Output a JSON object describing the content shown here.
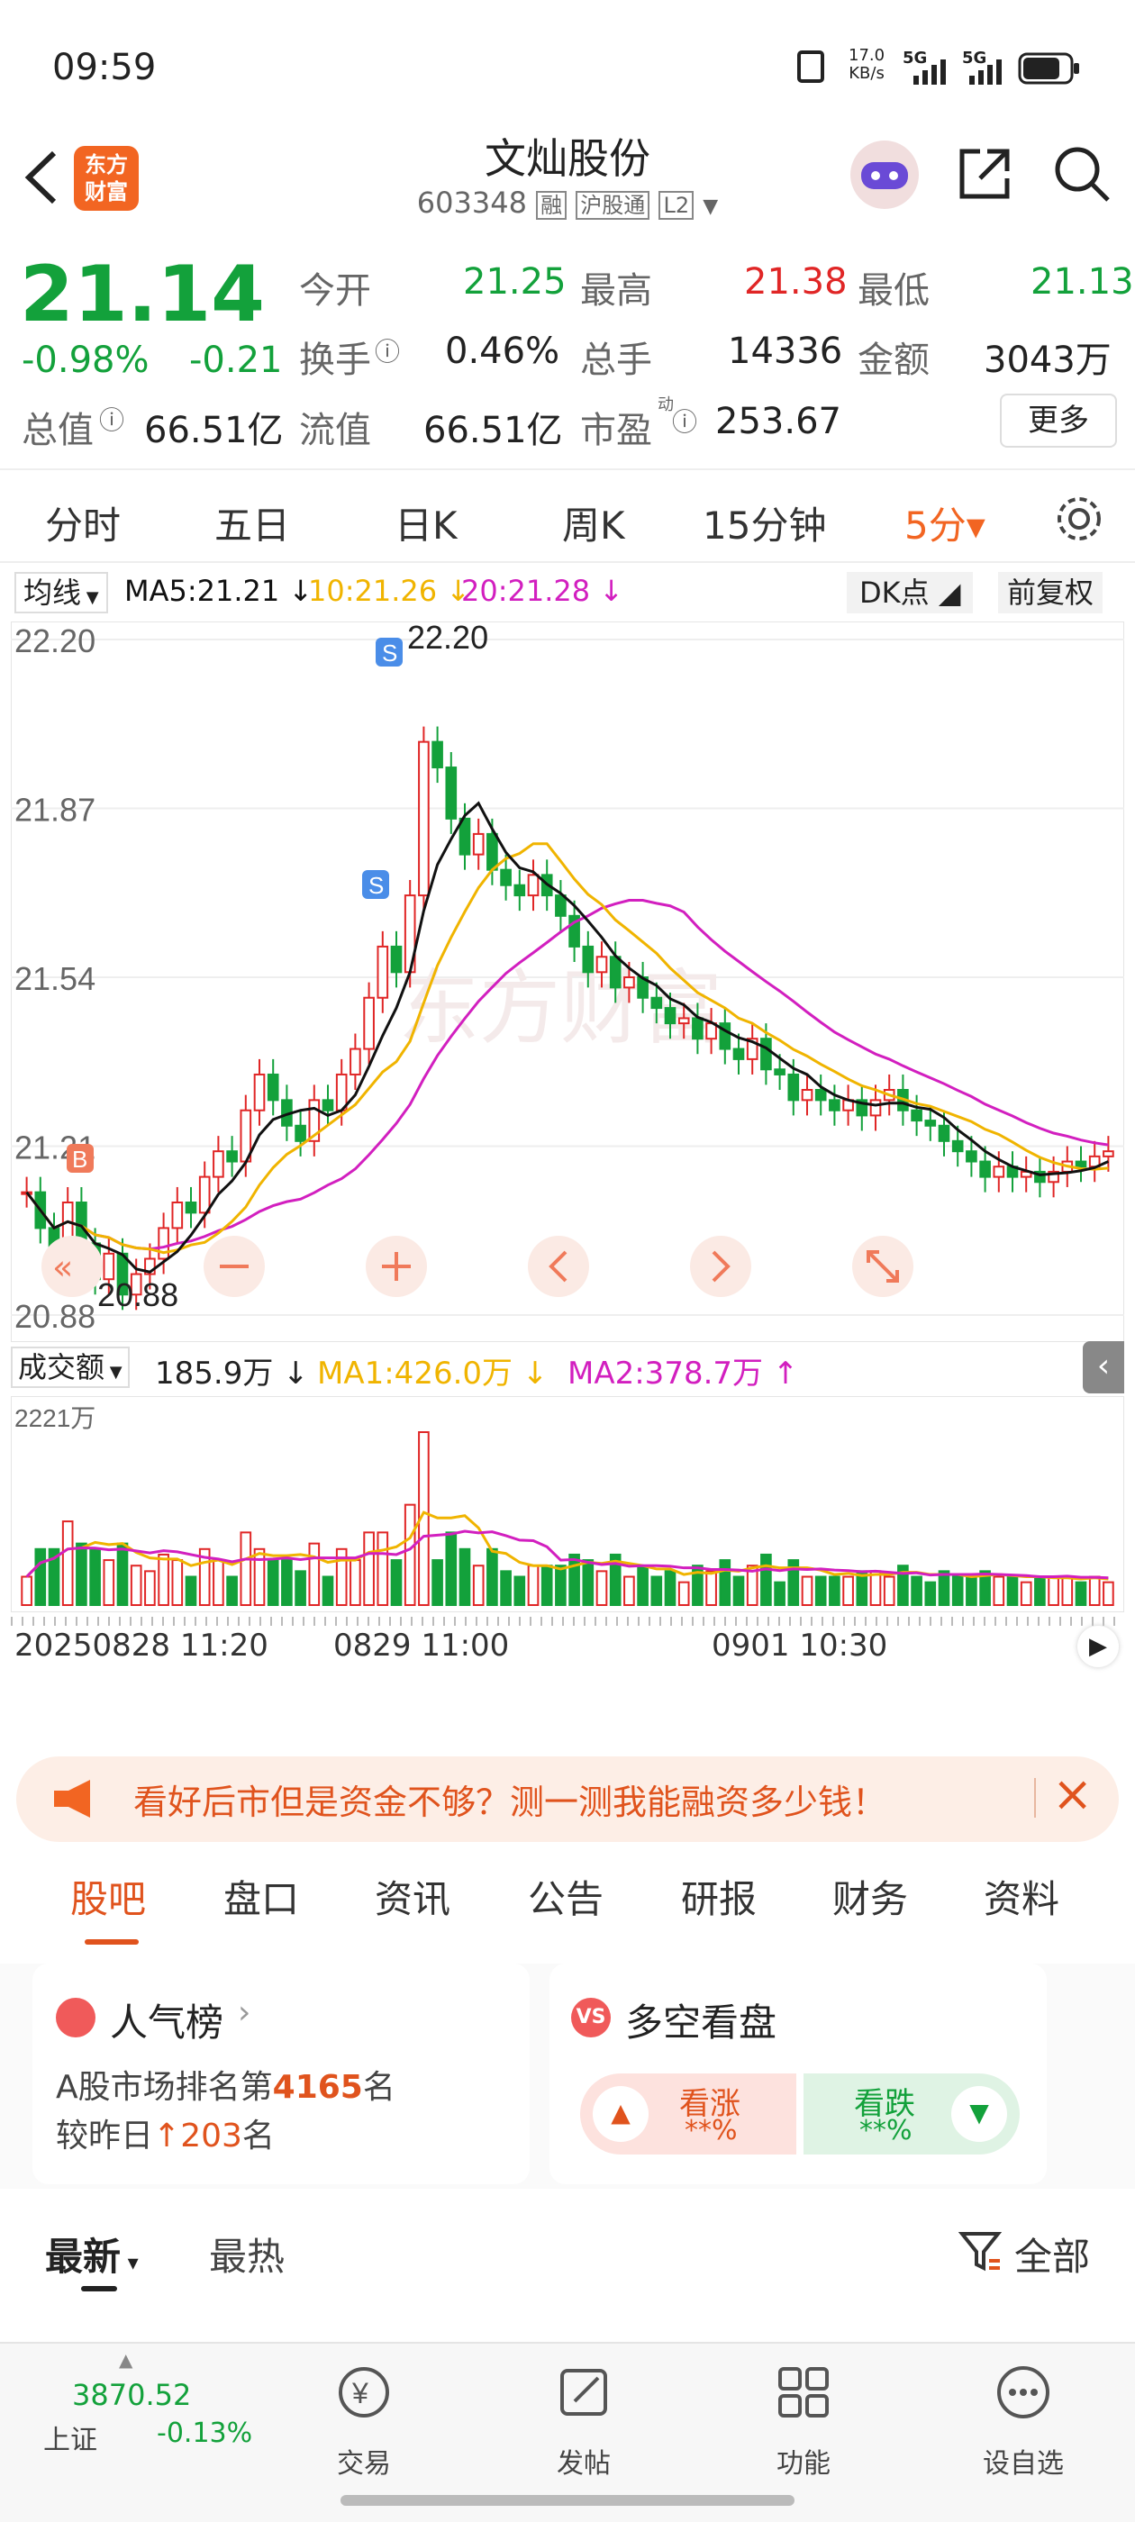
{
  "status_bar": {
    "time": "09:59",
    "net_speed": "17.0",
    "net_unit": "KB/s",
    "sig1": "5G",
    "sig2": "5G"
  },
  "header": {
    "logo_line1": "东方",
    "logo_line2": "财富",
    "title": "文灿股份",
    "code": "603348",
    "tag1": "融",
    "tag2": "沪股通",
    "tag3": "L2"
  },
  "quote": {
    "price": "21.14",
    "pct": "-0.98%",
    "chg": "-0.21",
    "open_label": "今开",
    "open": "21.25",
    "high_label": "最高",
    "high": "21.38",
    "low_label": "最低",
    "low": "21.13",
    "turnover_label": "换手",
    "turnover": "0.46%",
    "volume_label": "总手",
    "volume": "14336",
    "amount_label": "金额",
    "amount": "3043万",
    "mktcap_label": "总值",
    "mktcap": "66.51亿",
    "float_label": "流值",
    "float": "66.51亿",
    "pe_label": "市盈",
    "pe_sup": "动",
    "pe": "253.67",
    "more": "更多"
  },
  "kline_tabs": [
    "分时",
    "五日",
    "日K",
    "周K",
    "15分钟",
    "5分▾"
  ],
  "ma_bar": {
    "select": "均线",
    "ma5": "MA5:21.21 ↓",
    "ma10": "10:21.26 ↓",
    "ma20": "20:21.28 ↓",
    "dk": "DK点",
    "fq": "前复权"
  },
  "price_axis": [
    "22.20",
    "21.87",
    "21.54",
    "21.21",
    "20.88"
  ],
  "annotations": {
    "high": "22.20",
    "low": "20.88",
    "buy": "B",
    "sell": "S"
  },
  "vol_bar": {
    "select": "成交额",
    "value": "185.9万 ↓",
    "ma1": "MA1:426.0万 ↓",
    "ma2": "MA2:378.7万 ↑",
    "max": "2221万"
  },
  "time_axis": [
    "20250828 11:20",
    "0829 11:00",
    "0901 10:30"
  ],
  "colors": {
    "up": "#e02626",
    "down": "#13a13b",
    "ma5": "#111111",
    "ma10": "#f0b400",
    "ma20": "#d21fbf",
    "accent": "#f26522"
  },
  "ad": {
    "text": "看好后市但是资金不够？测一测我能融资多少钱！"
  },
  "info_tabs": [
    "股吧",
    "盘口",
    "资讯",
    "公告",
    "研报",
    "财务",
    "资料"
  ],
  "popularity": {
    "title": "人气榜",
    "line1_prefix": "A股市场排名第",
    "rank": "4165",
    "line1_suffix": "名",
    "line2_prefix": "较昨日",
    "change": "203",
    "line2_suffix": "名"
  },
  "sentiment": {
    "title": "多空看盘",
    "up": "看涨",
    "up_val": "**%",
    "down": "看跌",
    "down_val": "**%"
  },
  "sort": {
    "latest": "最新",
    "hot": "最热",
    "all": "全部"
  },
  "bottom_nav": {
    "index_value": "3870.52",
    "index_name": "上证",
    "index_pct": "-0.13%",
    "trade": "交易",
    "post": "发帖",
    "func": "功能",
    "watch": "设自选"
  },
  "chart_data": {
    "type": "candlestick",
    "ylim": [
      20.88,
      22.2
    ],
    "high": 22.2,
    "low": 20.88,
    "closes": [
      21.12,
      21.05,
      20.98,
      21.1,
      21.02,
      20.95,
      21.0,
      20.92,
      20.96,
      20.99,
      21.05,
      21.1,
      21.08,
      21.15,
      21.2,
      21.18,
      21.28,
      21.35,
      21.3,
      21.25,
      21.22,
      21.3,
      21.28,
      21.35,
      21.4,
      21.5,
      21.6,
      21.55,
      21.7,
      22.0,
      21.95,
      21.85,
      21.78,
      21.82,
      21.75,
      21.72,
      21.7,
      21.74,
      21.7,
      21.66,
      21.6,
      21.55,
      21.58,
      21.52,
      21.54,
      21.5,
      21.48,
      21.45,
      21.46,
      21.42,
      21.45,
      21.4,
      21.38,
      21.42,
      21.36,
      21.35,
      21.3,
      21.32,
      21.3,
      21.28,
      21.3,
      21.27,
      21.3,
      21.32,
      21.28,
      21.26,
      21.25,
      21.22,
      21.2,
      21.18,
      21.15,
      21.17,
      21.15,
      21.16,
      21.14,
      21.16,
      21.18,
      21.17,
      21.19,
      21.2
    ]
  }
}
